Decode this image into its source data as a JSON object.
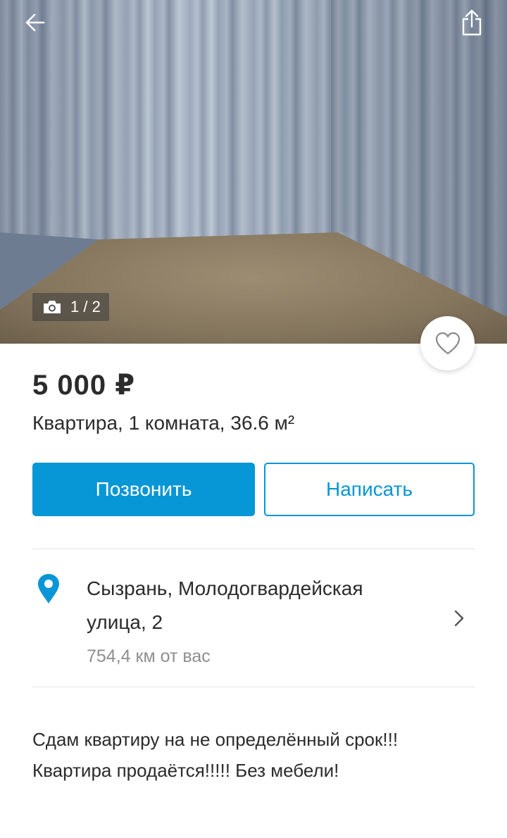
{
  "gallery": {
    "counter_text": "1 / 2",
    "icons": {
      "back": "arrow-left-icon",
      "share": "share-icon",
      "camera": "camera-icon",
      "favorite": "heart-icon"
    }
  },
  "listing": {
    "price": "5 000 ₽",
    "subtitle": "Квартира, 1 комната, 36.6 м²"
  },
  "actions": {
    "call_label": "Позвонить",
    "write_label": "Написать"
  },
  "location": {
    "address": "Сызрань, Молодогвардейская улица, 2",
    "distance": "754,4  км от вас",
    "icons": {
      "pin": "location-pin-icon",
      "chevron": "chevron-right-icon"
    }
  },
  "description": {
    "lines": [
      "Сдам квартиру на не определённый срок!!!",
      "Квартира продаётся!!!!! Без мебели!"
    ]
  },
  "colors": {
    "accent": "#0796d6",
    "text": "#2b2b2b",
    "muted": "#8e8e8e",
    "divider": "#e2e2e2"
  }
}
